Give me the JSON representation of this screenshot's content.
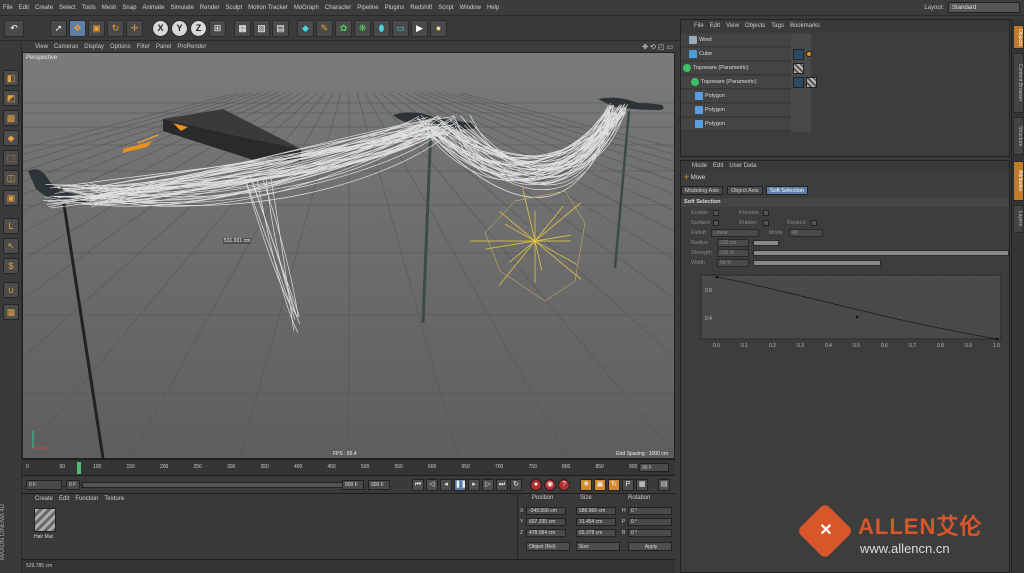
{
  "menubar": {
    "items": [
      "File",
      "Edit",
      "Create",
      "Select",
      "Tools",
      "Mesh",
      "Snap",
      "Animate",
      "Simulate",
      "Render",
      "Sculpt",
      "Motion Tracker",
      "MoGraph",
      "Character",
      "Pipeline",
      "Plugins",
      "Redshift",
      "Script",
      "Window",
      "Help"
    ],
    "layout_label": "Layout:",
    "layout_value": "Standard"
  },
  "toolbar": {
    "axis_x": "X",
    "axis_y": "Y",
    "axis_z": "Z"
  },
  "viewport": {
    "menu": [
      "View",
      "Cameras",
      "Display",
      "Options",
      "Filter",
      "Panel",
      "ProRender"
    ],
    "label": "Perspective",
    "fps": "FPS : 85.4",
    "grid_spacing": "Grid Spacing : 1000 cm",
    "measure": "531.931 cm"
  },
  "timeline": {
    "ticks": [
      "0",
      "50",
      "100",
      "150",
      "200",
      "250",
      "300",
      "350",
      "400",
      "450",
      "500",
      "550",
      "600",
      "650",
      "700",
      "750",
      "800",
      "850",
      "900"
    ],
    "end_frame": "90 F"
  },
  "playback": {
    "current": "0 F",
    "min": "0 F",
    "max": "900 F",
    "end": "900 F"
  },
  "material_manager": {
    "menu": [
      "Create",
      "Edit",
      "Function",
      "Texture"
    ],
    "material_name": "Hair Mat",
    "brand": "MAXON CINEMA 4D"
  },
  "coordinates": {
    "headers": [
      "Position",
      "Size",
      "Rotation"
    ],
    "rows": [
      {
        "axis": "X",
        "pos": "-349.556 cm",
        "size": "589.966 cm",
        "rot_label": "H",
        "rot": "0 °"
      },
      {
        "axis": "Y",
        "pos": "607.335 cm",
        "size": "31.454 cm",
        "rot_label": "P",
        "rot": "0 °"
      },
      {
        "axis": "Z",
        "pos": "478.084 cm",
        "size": "65.378 cm",
        "rot_label": "B",
        "rot": "0 °"
      }
    ],
    "mode_select": "Object (Rel)",
    "size_select": "Size",
    "apply": "Apply"
  },
  "status": "529.785 cm",
  "object_manager": {
    "menu": [
      "File",
      "Edit",
      "View",
      "Objects",
      "Tags",
      "Bookmarks"
    ],
    "objects": [
      {
        "name": "Wind",
        "color": "#9ab"
      },
      {
        "name": "Cube",
        "color": "#4a9ad8"
      },
      {
        "name": "Topoware (Parametric)",
        "color": "#3fc060"
      },
      {
        "name": "Topoware (Parametric)",
        "color": "#3fc060"
      },
      {
        "name": "Polygon",
        "color": "#5aa0e0"
      },
      {
        "name": "Polygon",
        "color": "#5aa0e0"
      },
      {
        "name": "Polygon",
        "color": "#5aa0e0"
      }
    ]
  },
  "attribute_manager": {
    "menu": [
      "Mode",
      "Edit",
      "User Data"
    ],
    "tool": "Move",
    "tabs": [
      "Modeling Axis",
      "Object Axis",
      "Soft Selection"
    ],
    "section": "Soft Selection",
    "enable": "Enable",
    "preview": "Preview",
    "surface": "Surface",
    "rubber": "Rubber",
    "restrict": "Restrict",
    "falloff": "Falloff",
    "falloff_value": "Linear",
    "mode": "Mode",
    "mode_value": "All",
    "radius": "Radius",
    "radius_value": "100 cm",
    "strength": "Strength",
    "strength_value": "100 %",
    "width": "Width",
    "width_value": "50 %",
    "curve_y_labels": [
      "0.8",
      "0.4"
    ],
    "curve_x_labels": [
      "0.0",
      "0.1",
      "0.2",
      "0.3",
      "0.4",
      "0.5",
      "0.6",
      "0.7",
      "0.8",
      "0.9",
      "1.0"
    ]
  },
  "right_tabs": [
    "Objects",
    "Content Browser",
    "Structure",
    "Attributes",
    "Layers"
  ],
  "watermark": {
    "brand": "ALLEN艾伦",
    "url": "www.allencn.cn"
  }
}
